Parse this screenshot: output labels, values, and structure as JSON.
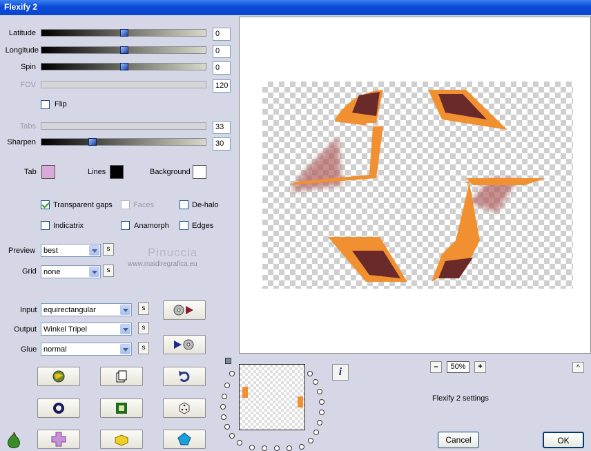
{
  "window": {
    "title": "Flexify 2"
  },
  "sliders": [
    {
      "label": "Latitude",
      "value": "0",
      "level": 0.5,
      "disabled": false
    },
    {
      "label": "Longitude",
      "value": "0",
      "level": 0.5,
      "disabled": false
    },
    {
      "label": "Spin",
      "value": "0",
      "level": 0.5,
      "disabled": false
    },
    {
      "label": "FOV",
      "value": "120",
      "disabled": true
    },
    {
      "label": "Tabs",
      "value": "33",
      "disabled": true
    },
    {
      "label": "Sharpen",
      "value": "30",
      "level": 0.3,
      "disabled": false
    }
  ],
  "flip": {
    "label": "Flip",
    "checked": false
  },
  "colors": {
    "tab_label": "Tab",
    "tab_color": "#d9a9d9",
    "lines_label": "Lines",
    "lines_color": "#000000",
    "background_label": "Background",
    "background_color": "#ffffff"
  },
  "options": {
    "transparent_gaps": {
      "label": "Transparent gaps",
      "checked": true
    },
    "faces": {
      "label": "Faces",
      "checked": false,
      "disabled": true
    },
    "de_halo": {
      "label": "De-halo",
      "checked": false
    },
    "indicatrix": {
      "label": "Indicatrix",
      "checked": false
    },
    "anamorph": {
      "label": "Anamorph",
      "checked": false
    },
    "edges": {
      "label": "Edges",
      "checked": false
    }
  },
  "preview_select": {
    "label": "Preview",
    "value": "best"
  },
  "grid_select": {
    "label": "Grid",
    "value": "none"
  },
  "watermark": {
    "name": "Pinuccia",
    "url": "www.maidiregrafica.eu"
  },
  "input_select": {
    "label": "Input",
    "value": "equirectangular"
  },
  "output_select": {
    "label": "Output",
    "value": "Winkel Tripel"
  },
  "glue_select": {
    "label": "Glue",
    "value": "normal"
  },
  "s_button": "s",
  "zoom": {
    "value": "50%",
    "minus": "–",
    "plus": "+"
  },
  "status": "Flexify 2 settings",
  "info_button": "i",
  "collapse_button": "^",
  "cancel_label": "Cancel",
  "ok_label": "OK"
}
